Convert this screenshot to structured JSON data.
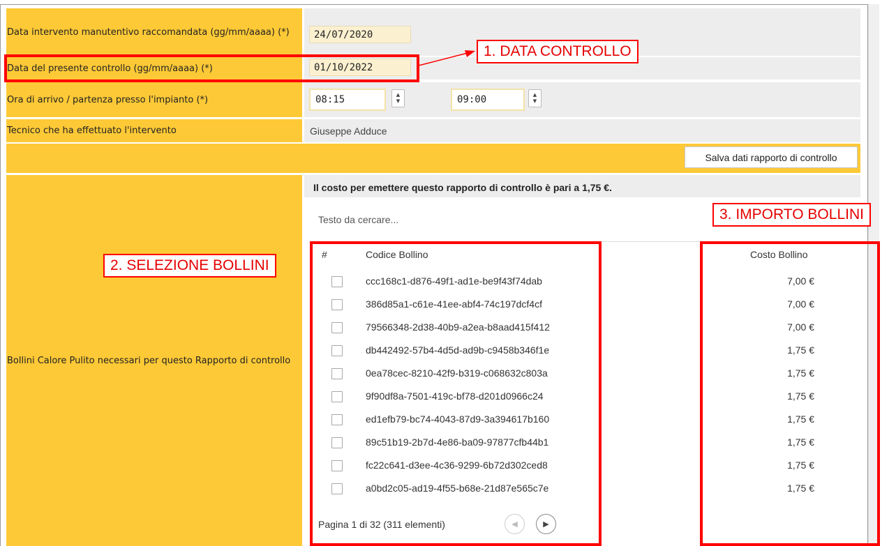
{
  "form": {
    "rows": {
      "data_raccomandata": {
        "label": "Data intervento manutentivo raccomandata (gg/mm/aaaa) (*)",
        "value": "24/07/2020"
      },
      "data_controllo": {
        "label": "Data del presente controllo (gg/mm/aaaa) (*)",
        "value": "01/10/2022"
      },
      "ora": {
        "label": "Ora di arrivo / partenza presso l'impianto (*)",
        "arrivo": "08:15",
        "partenza": "09:00"
      },
      "tecnico": {
        "label": "Tecnico che ha effettuato l'intervento",
        "value": "Giuseppe Adduce"
      }
    },
    "save_button": "Salva dati rapporto di controllo",
    "bollini": {
      "label": "Bollini Calore Pulito necessari per questo Rapporto di controllo",
      "cost_message": "Il costo per emettere questo rapporto di controllo è pari a 1,75 €.",
      "search_placeholder": "Testo da cercare...",
      "headers": {
        "index": "#",
        "code": "Codice Bollino",
        "cost": "Costo Bollino"
      },
      "items": [
        {
          "code": "ccc168c1-d876-49f1-ad1e-be9f43f74dab",
          "cost": "7,00 €",
          "checked": false
        },
        {
          "code": "386d85a1-c61e-41ee-abf4-74c197dcf4cf",
          "cost": "7,00 €",
          "checked": false
        },
        {
          "code": "79566348-2d38-40b9-a2ea-b8aad415f412",
          "cost": "7,00 €",
          "checked": false
        },
        {
          "code": "db442492-57b4-4d5d-ad9b-c9458b346f1e",
          "cost": "1,75 €",
          "checked": false
        },
        {
          "code": "0ea78cec-8210-42f9-b319-c068632c803a",
          "cost": "1,75 €",
          "checked": false
        },
        {
          "code": "9f90df8a-7501-419c-bf78-d201d0966c24",
          "cost": "1,75 €",
          "checked": false
        },
        {
          "code": "ed1efb79-bc74-4043-87d9-3a394617b160",
          "cost": "1,75 €",
          "checked": false
        },
        {
          "code": "89c51b19-2b7d-4e86-ba09-97877cfb44b1",
          "cost": "1,75 €",
          "checked": false
        },
        {
          "code": "fc22c641-d3ee-4c36-9299-6b72d302ced8",
          "cost": "1,75 €",
          "checked": false
        },
        {
          "code": "a0bd2c05-ad19-4f55-b68e-21d87e565c7e",
          "cost": "1,75 €",
          "checked": false
        }
      ],
      "pager": {
        "text": "Pagina 1 di 32 (311 elementi)",
        "prev_icon": "chevron-left-icon",
        "next_icon": "chevron-right-icon"
      }
    }
  },
  "annotations": {
    "callout1": "1. DATA CONTROLLO",
    "callout2": "2. SELEZIONE BOLLINI",
    "callout3": "3. IMPORTO BOLLINI",
    "color": "#ff0000"
  },
  "colors": {
    "label_bg": "#fdc936",
    "value_bg": "#ededed",
    "date_field_bg": "#fbf0cf"
  }
}
